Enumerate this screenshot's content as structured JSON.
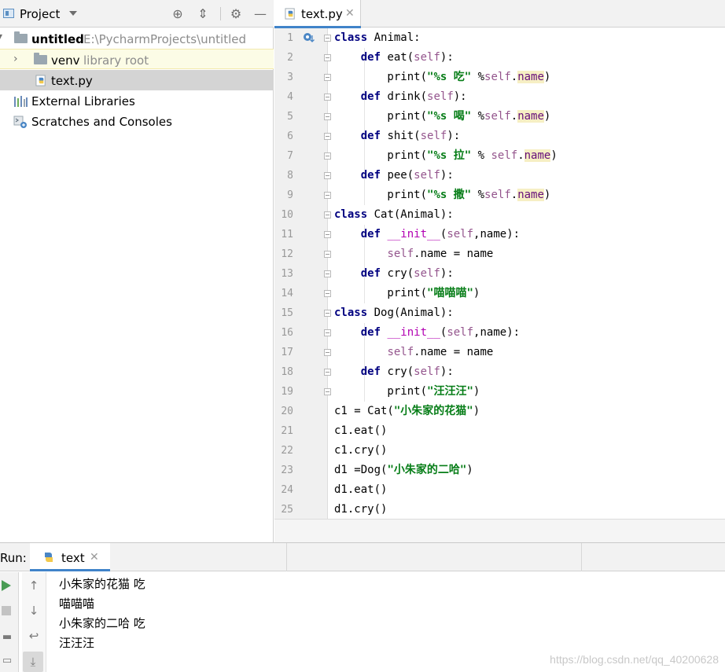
{
  "project_panel": {
    "title": "Project",
    "tree": [
      {
        "name": "untitled",
        "sub": "E:\\PycharmProjects\\untitled"
      },
      {
        "name": "venv",
        "sub": "library root"
      },
      {
        "name": "text.py"
      },
      {
        "name": "External Libraries"
      },
      {
        "name": "Scratches and Consoles"
      }
    ]
  },
  "editor": {
    "tab_label": "text.py",
    "line_numbers": [
      "1",
      "2",
      "3",
      "4",
      "5",
      "6",
      "7",
      "8",
      "9",
      "10",
      "11",
      "12",
      "13",
      "14",
      "15",
      "16",
      "17",
      "18",
      "19",
      "20",
      "21",
      "22",
      "23",
      "24",
      "25"
    ]
  },
  "run_panel": {
    "label": "Run:",
    "tab_label": "text",
    "output": [
      "小朱家的花猫 吃",
      "喵喵喵",
      "小朱家的二哈 吃",
      "汪汪汪"
    ]
  },
  "watermark": "https://blog.csdn.net/qq_40200628",
  "colors": {
    "accent": "#4083c9",
    "keyword": "#000080",
    "string": "#067d17",
    "self": "#94558d",
    "run_green": "#499c54"
  }
}
